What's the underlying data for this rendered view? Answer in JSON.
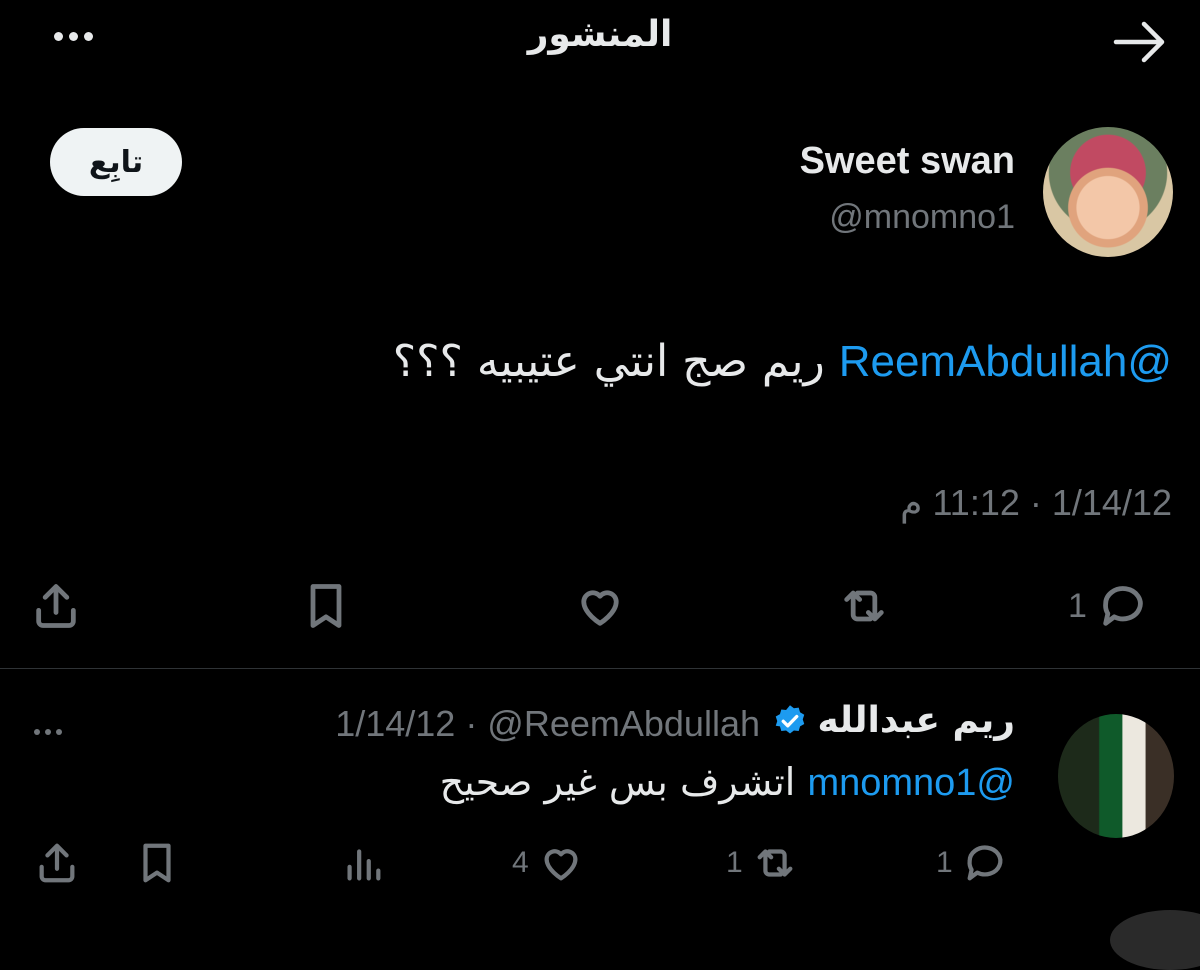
{
  "header": {
    "title": "المنشور"
  },
  "post": {
    "display_name": "Sweet swan",
    "handle": "@mnomno1",
    "follow_label": "تابِع",
    "mention": "@ReemAbdullah",
    "text_body": " ريم صج انتي عتيبيه ؟؟؟",
    "meta": "1/14/12 · 11:12 م",
    "actions": {
      "reply_count": "1"
    }
  },
  "reply": {
    "display_name": "ريم عبدالله",
    "meta": "1/14/12 · @ReemAbdullah",
    "mention": "@mnomno1",
    "text_body": " اتشرف بس غير صحيح",
    "actions": {
      "reply_count": "1",
      "retweet_count": "1",
      "like_count": "4"
    }
  },
  "colors": {
    "accent": "#1d9bf0",
    "muted": "#71767b",
    "background": "#000000"
  }
}
